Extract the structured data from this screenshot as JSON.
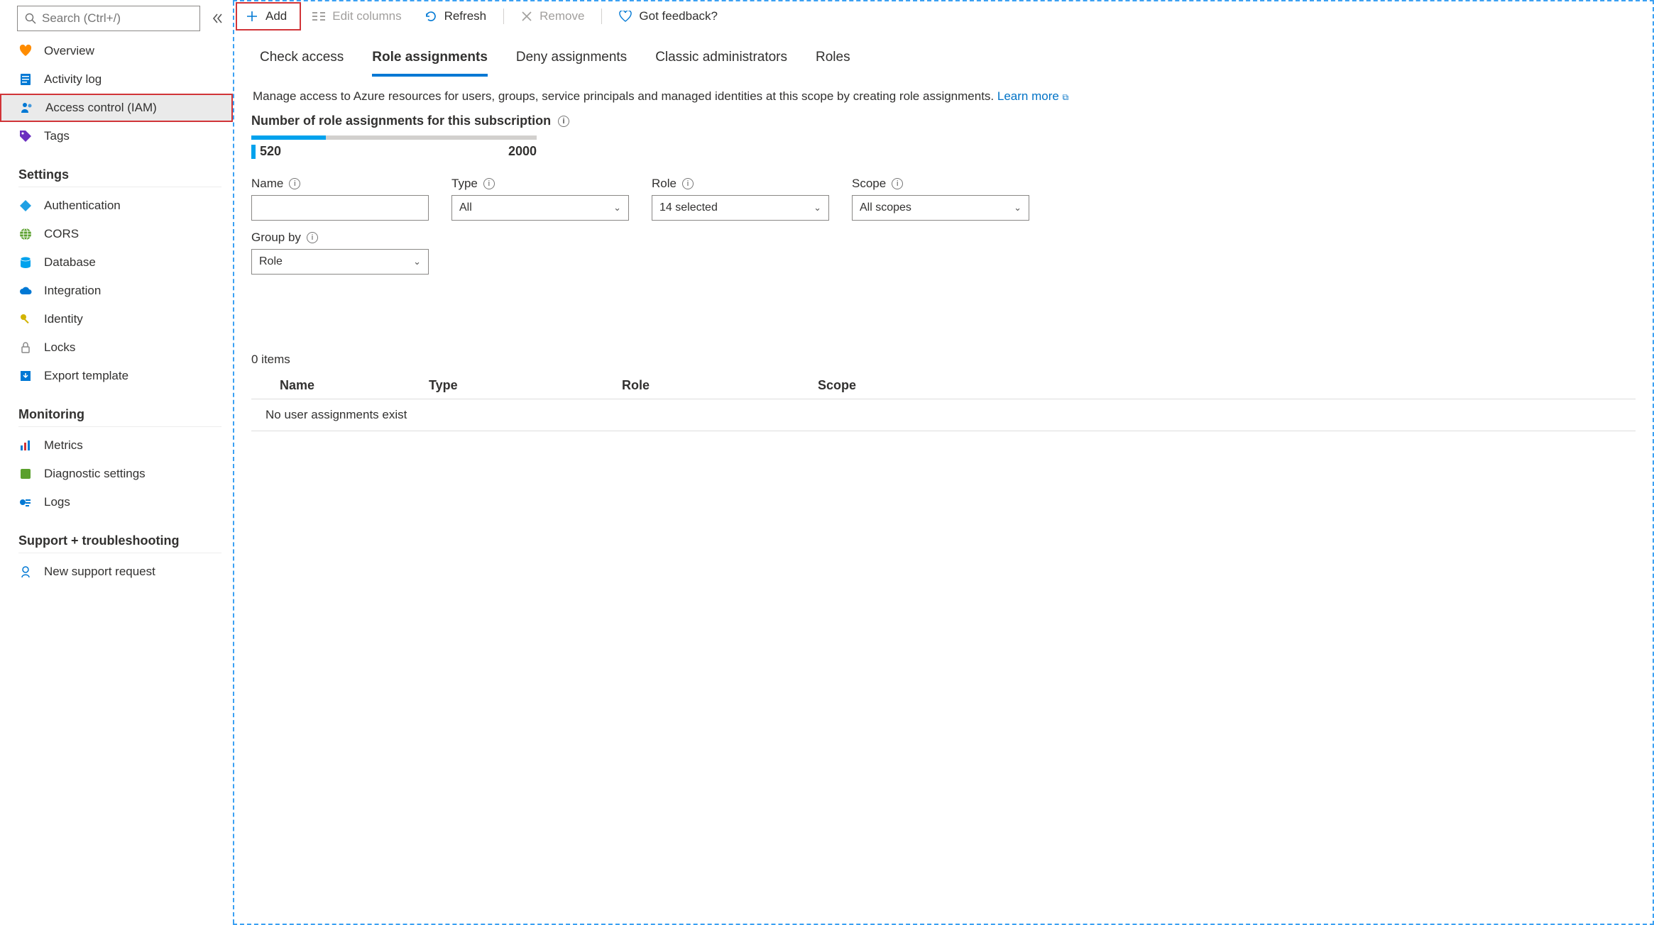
{
  "sidebar": {
    "search_placeholder": "Search (Ctrl+/)",
    "items_top": [
      {
        "label": "Overview",
        "icon": "heart-icon",
        "color": "#ff8c00"
      },
      {
        "label": "Activity log",
        "icon": "log-icon",
        "color": "#0078d4"
      },
      {
        "label": "Access control (IAM)",
        "icon": "people-icon",
        "color": "#0078d4",
        "selected": true,
        "highlight": true
      },
      {
        "label": "Tags",
        "icon": "tag-icon",
        "color": "#6b2fbf"
      }
    ],
    "groups": [
      {
        "title": "Settings",
        "items": [
          {
            "label": "Authentication",
            "icon": "auth-icon",
            "color": "#1fa0e4"
          },
          {
            "label": "CORS",
            "icon": "globe-icon",
            "color": "#5aa02c"
          },
          {
            "label": "Database",
            "icon": "database-icon",
            "color": "#00a2ed"
          },
          {
            "label": "Integration",
            "icon": "cloud-icon",
            "color": "#0078d4"
          },
          {
            "label": "Identity",
            "icon": "key-icon",
            "color": "#d2b300"
          },
          {
            "label": "Locks",
            "icon": "lock-icon",
            "color": "#888"
          },
          {
            "label": "Export template",
            "icon": "export-icon",
            "color": "#0078d4"
          }
        ]
      },
      {
        "title": "Monitoring",
        "items": [
          {
            "label": "Metrics",
            "icon": "chart-icon",
            "color": "#0078d4"
          },
          {
            "label": "Diagnostic settings",
            "icon": "diag-icon",
            "color": "#5aa02c"
          },
          {
            "label": "Logs",
            "icon": "logs-icon",
            "color": "#0078d4"
          }
        ]
      },
      {
        "title": "Support + troubleshooting",
        "items": [
          {
            "label": "New support request",
            "icon": "support-icon",
            "color": "#0078d4"
          }
        ]
      }
    ]
  },
  "toolbar": {
    "add_label": "Add",
    "edit_columns_label": "Edit columns",
    "refresh_label": "Refresh",
    "remove_label": "Remove",
    "feedback_label": "Got feedback?"
  },
  "tabs": [
    {
      "label": "Check access"
    },
    {
      "label": "Role assignments",
      "active": true
    },
    {
      "label": "Deny assignments"
    },
    {
      "label": "Classic administrators"
    },
    {
      "label": "Roles"
    }
  ],
  "description": "Manage access to Azure resources for users, groups, service principals and managed identities at this scope by creating role assignments.",
  "learn_more": "Learn more",
  "quota": {
    "title": "Number of role assignments for this subscription",
    "current": "520",
    "max": "2000",
    "percent": 26
  },
  "filters": {
    "name_label": "Name",
    "name_value": "",
    "type_label": "Type",
    "type_value": "All",
    "role_label": "Role",
    "role_value": "14 selected",
    "scope_label": "Scope",
    "scope_value": "All scopes",
    "group_by_label": "Group by",
    "group_by_value": "Role"
  },
  "table": {
    "count_text": "0 items",
    "columns": [
      "Name",
      "Type",
      "Role",
      "Scope"
    ],
    "empty_text": "No user assignments exist"
  }
}
